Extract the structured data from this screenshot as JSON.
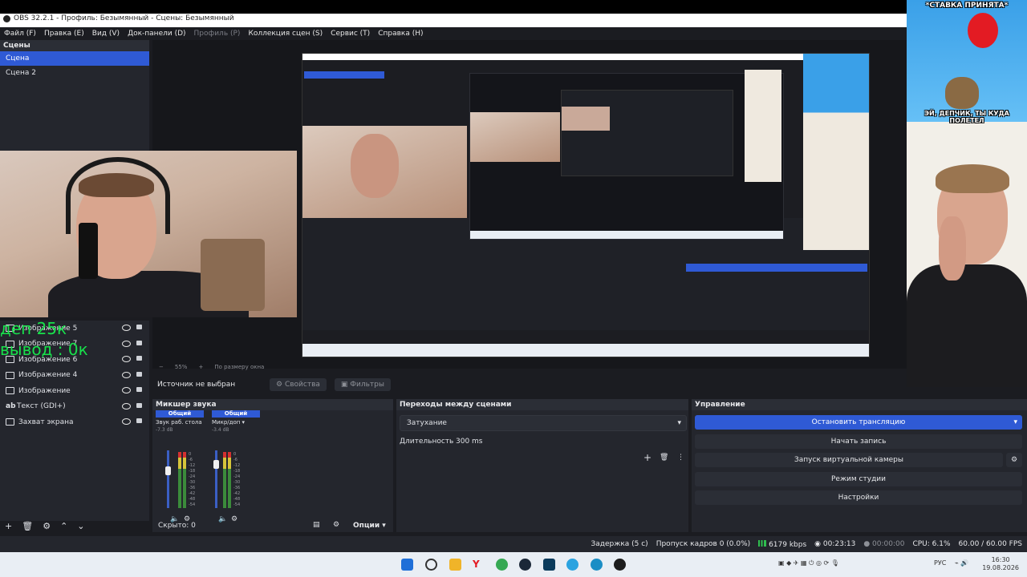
{
  "window": {
    "title": "OBS 32.2.1 - Профиль: Безымянный - Сцены: Безымянный"
  },
  "menu": [
    {
      "label": "Файл (F)",
      "enabled": true
    },
    {
      "label": "Правка (E)",
      "enabled": true
    },
    {
      "label": "Вид (V)",
      "enabled": true
    },
    {
      "label": "Док-панели (D)",
      "enabled": true
    },
    {
      "label": "Профиль (P)",
      "enabled": false
    },
    {
      "label": "Коллекция сцен (S)",
      "enabled": true
    },
    {
      "label": "Сервис (T)",
      "enabled": true
    },
    {
      "label": "Справка (H)",
      "enabled": true
    }
  ],
  "scenes": {
    "title": "Сцены",
    "items": [
      {
        "label": "Сцена",
        "selected": true
      },
      {
        "label": "Сцена 2",
        "selected": false
      }
    ]
  },
  "overlay": {
    "line1": "деп 25к",
    "line2": "вывод : 0к"
  },
  "sources": {
    "items": [
      {
        "label": "Изображение 5"
      },
      {
        "label": "Изображение 7"
      },
      {
        "label": "Изображение 6"
      },
      {
        "label": "Изображение 4"
      },
      {
        "label": "Изображение"
      },
      {
        "label": "Текст (GDI+)"
      },
      {
        "label": "Захват экрана"
      }
    ]
  },
  "zoom": {
    "value": "55%",
    "mode": "По размеру окна"
  },
  "properties": {
    "no_source": "Источник не выбран",
    "properties_btn": "Свойства",
    "filters_btn": "Фильтры"
  },
  "mixer": {
    "title": "Микшер звука",
    "channels": [
      {
        "tag": "Общий",
        "name": "Звук раб. стола",
        "db": "-7.3 dB"
      },
      {
        "tag": "Общий",
        "name": "Микр/доп",
        "db": "-3.4 dB"
      }
    ],
    "scale": [
      "0",
      "-6",
      "-12",
      "-18",
      "-24",
      "-30",
      "-36",
      "-42",
      "-48",
      "-54",
      "-60"
    ],
    "hidden": "Скрыто: 0",
    "options": "Опции"
  },
  "transitions": {
    "title": "Переходы между сценами",
    "type": "Затухание",
    "duration_label": "Длительность",
    "duration_value": "300 ms"
  },
  "controls": {
    "title": "Управление",
    "buttons": [
      {
        "label": "Остановить трансляцию",
        "primary": true
      },
      {
        "label": "Начать запись",
        "primary": false
      },
      {
        "label": "Запуск виртуальной камеры",
        "primary": false
      },
      {
        "label": "Режим студии",
        "primary": false
      },
      {
        "label": "Настройки",
        "primary": false
      }
    ]
  },
  "status": {
    "delay": "Задержка (5 c)",
    "dropped": "Пропуск кадров 0 (0.0%)",
    "bitrate": "6179 kbps",
    "stream_time": "00:23:13",
    "record_time": "00:00:00",
    "cpu": "CPU: 6.1%",
    "fps": "60.00 / 60.00 FPS"
  },
  "meme": {
    "caption_top": "*СТАВКА ПРИНЯТА*",
    "caption_mid": "ЭЙ, ДЕПЧИК, ТЫ КУДА ПОЛЕТЕЛ"
  },
  "taskbar": {
    "lang": "РУС",
    "time": "16:30",
    "date": "19.08.2026"
  },
  "colors": {
    "accent": "#2f5ad5",
    "overlay_green": "#18e04b",
    "panel": "#24262d",
    "bg": "#1b1c21"
  }
}
